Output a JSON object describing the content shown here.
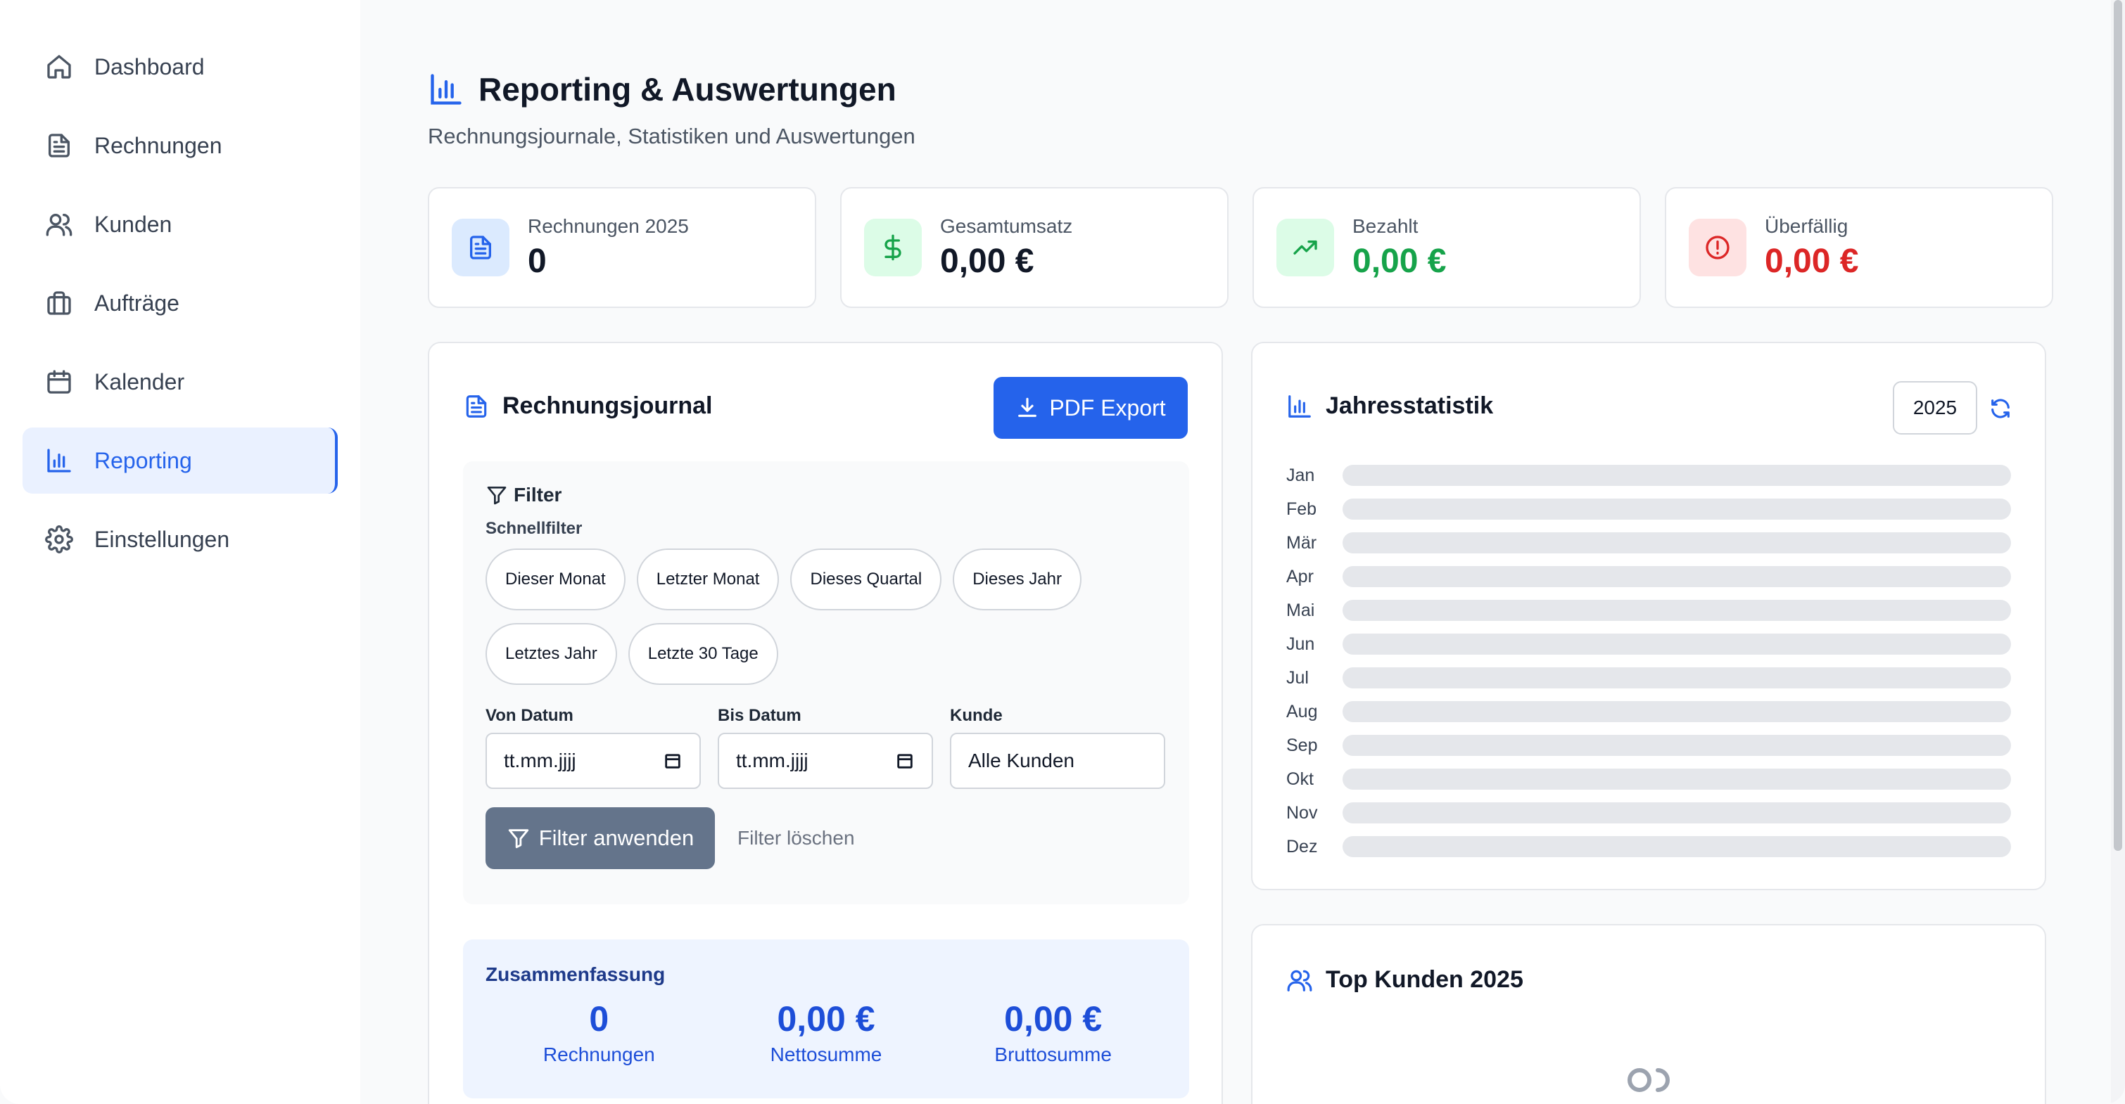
{
  "sidebar": {
    "items": [
      {
        "label": "Dashboard",
        "icon": "home-icon"
      },
      {
        "label": "Rechnungen",
        "icon": "file-icon"
      },
      {
        "label": "Kunden",
        "icon": "users-icon"
      },
      {
        "label": "Aufträge",
        "icon": "briefcase-icon"
      },
      {
        "label": "Kalender",
        "icon": "calendar-icon"
      },
      {
        "label": "Reporting",
        "icon": "bar-chart-icon",
        "active": true
      },
      {
        "label": "Einstellungen",
        "icon": "gear-icon"
      }
    ]
  },
  "header": {
    "title": "Reporting & Auswertungen",
    "subtitle": "Rechnungsjournale, Statistiken und Auswertungen"
  },
  "stats": [
    {
      "label": "Rechnungen 2025",
      "value": "0",
      "color": "#111827",
      "icon_bg": "#dbeafe",
      "icon_color": "#2563eb",
      "icon": "file-icon"
    },
    {
      "label": "Gesamtumsatz",
      "value": "0,00 €",
      "color": "#111827",
      "icon_bg": "#dcfce7",
      "icon_color": "#16a34a",
      "icon": "dollar-icon"
    },
    {
      "label": "Bezahlt",
      "value": "0,00 €",
      "color": "#16a34a",
      "icon_bg": "#dcfce7",
      "icon_color": "#16a34a",
      "icon": "trending-up-icon"
    },
    {
      "label": "Überfällig",
      "value": "0,00 €",
      "color": "#dc2626",
      "icon_bg": "#fee2e2",
      "icon_color": "#dc2626",
      "icon": "alert-circle-icon"
    }
  ],
  "journal": {
    "title": "Rechnungsjournal",
    "pdf_export_label": "PDF Export",
    "filter_title": "Filter",
    "quick_filter_label": "Schnellfilter",
    "quick_filters": [
      "Dieser Monat",
      "Letzter Monat",
      "Dieses Quartal",
      "Dieses Jahr",
      "Letztes Jahr",
      "Letzte 30 Tage"
    ],
    "from_label": "Von Datum",
    "from_value": "tt.mm.jjjj",
    "to_label": "Bis Datum",
    "to_value": "tt.mm.jjjj",
    "customer_label": "Kunde",
    "customer_value": "Alle Kunden",
    "apply_label": "Filter anwenden",
    "clear_label": "Filter löschen",
    "summary": {
      "title": "Zusammenfassung",
      "items": [
        {
          "value": "0",
          "label": "Rechnungen"
        },
        {
          "value": "0,00 €",
          "label": "Nettosumme"
        },
        {
          "value": "0,00 €",
          "label": "Bruttosumme"
        }
      ]
    }
  },
  "year_stats": {
    "title": "Jahresstatistik",
    "year": "2025",
    "months": [
      {
        "label": "Jan",
        "value": 0
      },
      {
        "label": "Feb",
        "value": 0
      },
      {
        "label": "Mär",
        "value": 0
      },
      {
        "label": "Apr",
        "value": 0
      },
      {
        "label": "Mai",
        "value": 0
      },
      {
        "label": "Jun",
        "value": 0
      },
      {
        "label": "Jul",
        "value": 0
      },
      {
        "label": "Aug",
        "value": 0
      },
      {
        "label": "Sep",
        "value": 0
      },
      {
        "label": "Okt",
        "value": 0
      },
      {
        "label": "Nov",
        "value": 0
      },
      {
        "label": "Dez",
        "value": 0
      }
    ]
  },
  "top_customers": {
    "title": "Top Kunden 2025"
  }
}
